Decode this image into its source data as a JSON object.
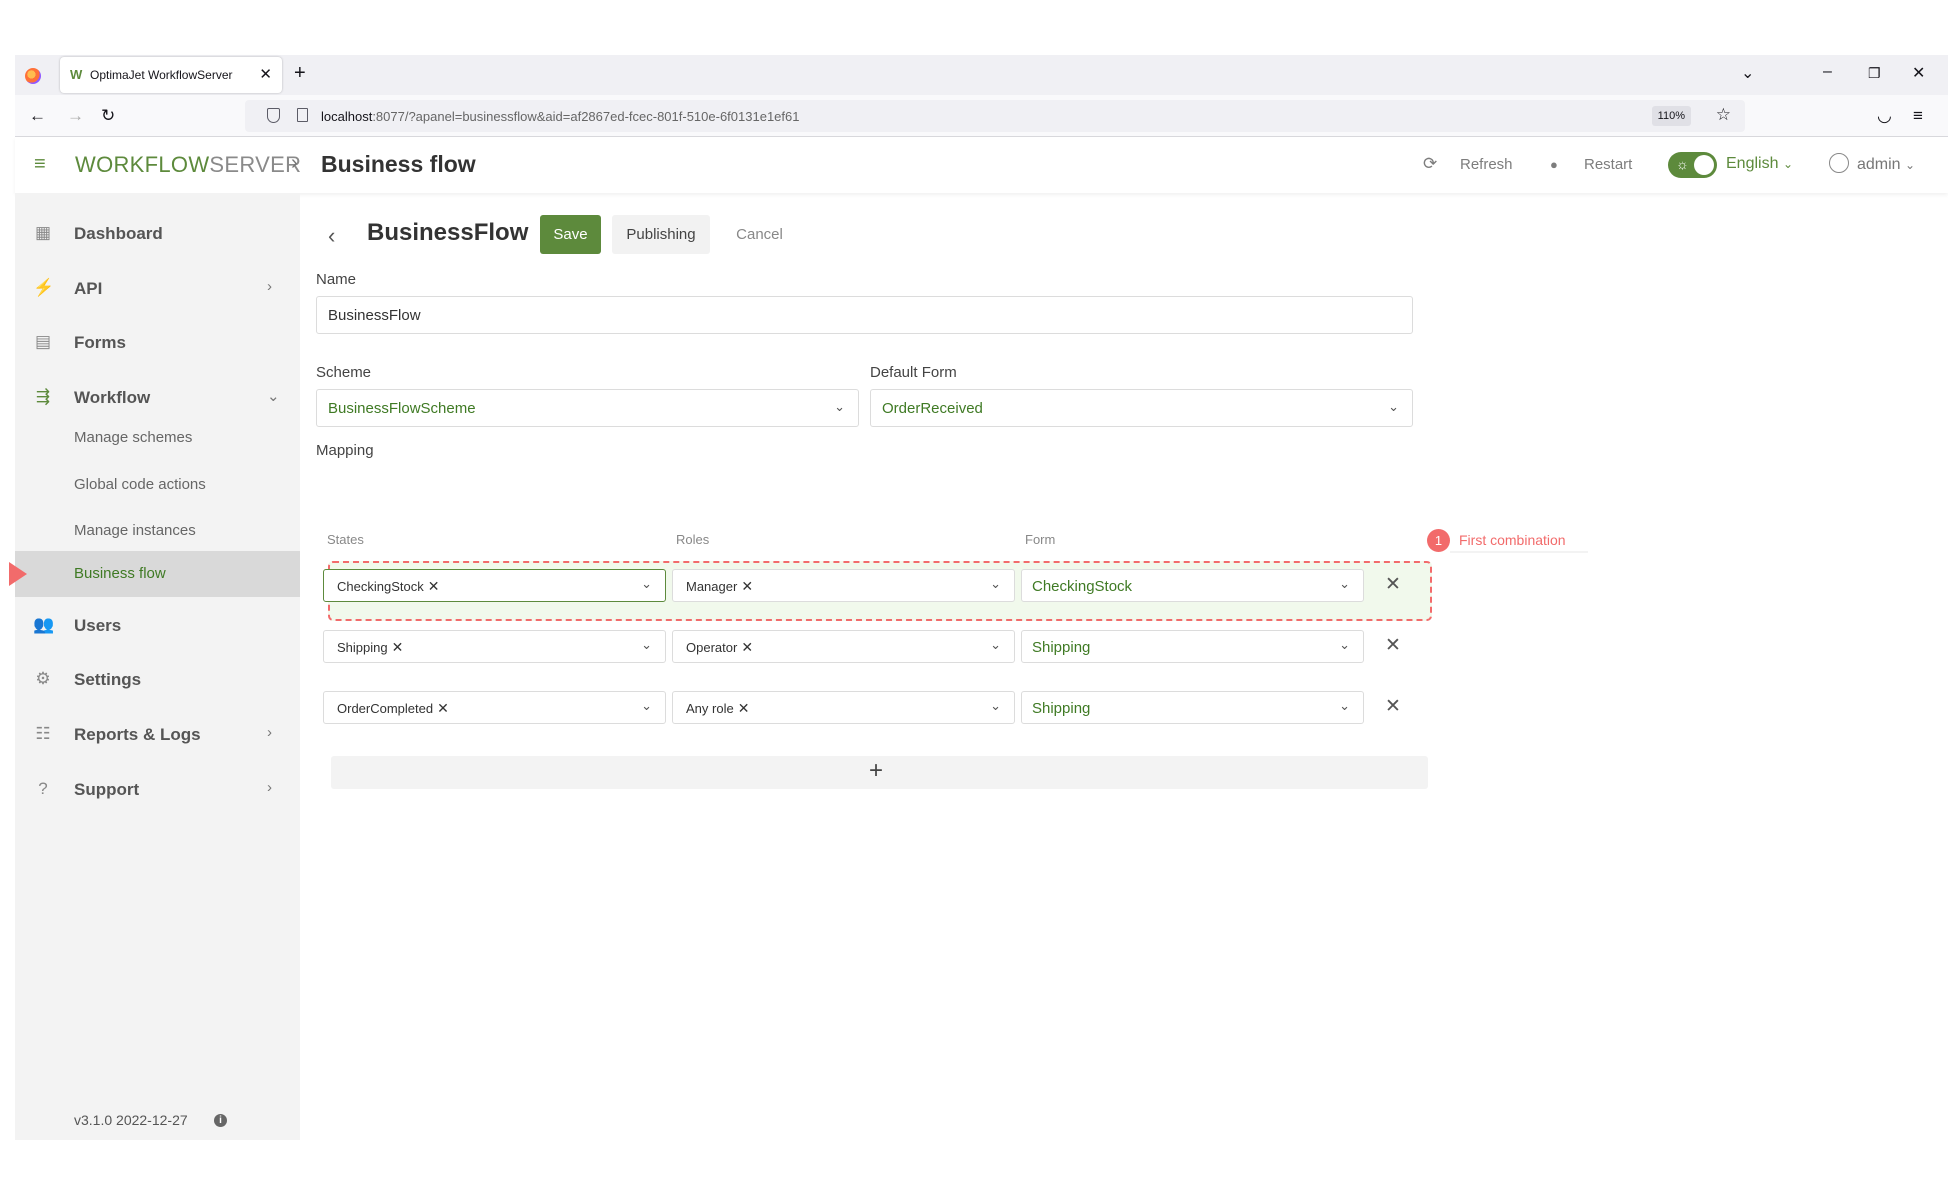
{
  "browser": {
    "tab_title": "OptimaJet WorkflowServer",
    "url_host": "localhost",
    "url_rest": ":8077/?apanel=businessflow&aid=af2867ed-fcec-801f-510e-6f0131e1ef61",
    "zoom": "110%"
  },
  "header": {
    "brand_primary": "WORKFLOW",
    "brand_secondary": "SERVER",
    "page_title": "Business flow",
    "refresh_label": "Refresh",
    "restart_label": "Restart",
    "language": "English",
    "user": "admin"
  },
  "sidebar": {
    "items": [
      {
        "label": "Dashboard",
        "icon": "dashboard-icon"
      },
      {
        "label": "API",
        "icon": "plug-icon"
      },
      {
        "label": "Forms",
        "icon": "forms-icon"
      },
      {
        "label": "Workflow",
        "icon": "workflow-icon"
      },
      {
        "label": "Users",
        "icon": "users-icon"
      },
      {
        "label": "Settings",
        "icon": "gears-icon"
      },
      {
        "label": "Reports & Logs",
        "icon": "reports-icon"
      },
      {
        "label": "Support",
        "icon": "help-icon"
      }
    ],
    "workflow_sub": [
      "Manage schemes",
      "Global code actions",
      "Manage instances",
      "Business flow"
    ],
    "version": "v3.1.0 2022-12-27"
  },
  "form": {
    "title": "BusinessFlow",
    "save_label": "Save",
    "publishing_label": "Publishing",
    "cancel_label": "Cancel",
    "name_label": "Name",
    "name_value": "BusinessFlow",
    "scheme_label": "Scheme",
    "scheme_value": "BusinessFlowScheme",
    "default_form_label": "Default Form",
    "default_form_value": "OrderReceived",
    "mapping_label": "Mapping",
    "columns": {
      "states": "States",
      "roles": "Roles",
      "form": "Form"
    },
    "error_count": "1",
    "error_message": "First combination",
    "rows": [
      {
        "state": "CheckingStock",
        "role": "Manager",
        "form": "CheckingStock"
      },
      {
        "state": "Shipping",
        "role": "Operator",
        "form": "Shipping"
      },
      {
        "state": "OrderCompleted",
        "role": "Any role",
        "form": "Shipping"
      }
    ]
  },
  "colors": {
    "accent": "#5d8a3c",
    "error": "#f26b6b"
  }
}
